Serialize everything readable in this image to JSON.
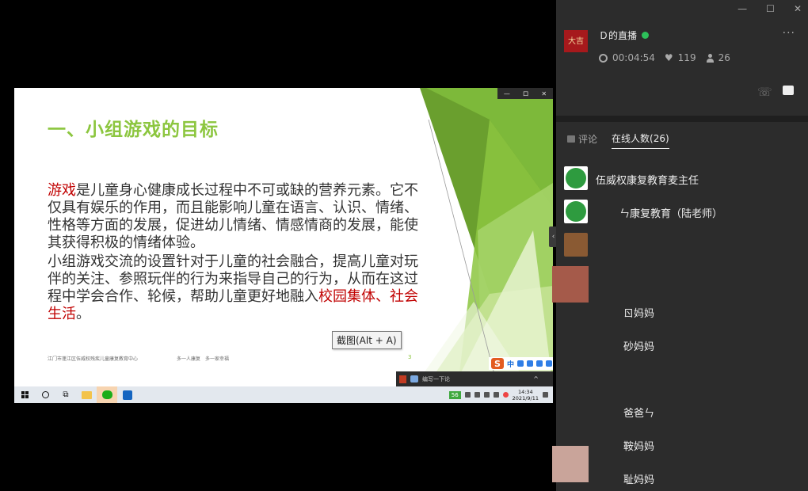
{
  "slide": {
    "title": "一、小组游戏的目标",
    "para1_highlight": "游戏",
    "para1_text": "是儿童身心健康成长过程中不可或缺的营养元素。它不仅具有娱乐的作用，而且能影响儿童在语言、认识、情绪、性格等方面的发展，促进幼儿情绪、情感情商的发展，能使其获得积极的情绪体验。",
    "para2_text": "小组游戏交流的设置针对于儿童的社会融合，提高儿童对玩伴的关注、参照玩伴的行为来指导自己的行为，从而在这过程中学会合作、轮候，帮助儿童更好地融入",
    "para2_highlight": "校园集体、社会生活",
    "para2_end": "。",
    "footer_org": "江门市蓬江区伍威权残疾儿童康复教育中心",
    "footer_slogan": "多一人康复　多一家幸福",
    "page_number": "3",
    "window_controls": [
      "—",
      "ロ",
      "✕"
    ]
  },
  "snip_tooltip": "截图(Alt + A)",
  "ime": {
    "text": "中"
  },
  "notification": {
    "text": "编写一下论"
  },
  "taskbar": {
    "battery": "56",
    "time": "14:34",
    "date": "2021/9/11"
  },
  "panel": {
    "window_controls": [
      "—",
      "☐",
      "✕"
    ],
    "host_avatar_text": "大吉",
    "live_title": "Ｄ的直播",
    "duration": "00:04:54",
    "likes": "119",
    "viewers": "26",
    "more": "···",
    "tabs": {
      "comment": "评论",
      "online": "在线人数(26)"
    },
    "members": [
      {
        "name": "伍威权康复教育麦主任"
      },
      {
        "name": "ㄣ康复教育（陆老师）"
      },
      {
        "name": ""
      },
      {
        "name": ""
      },
      {
        "name": "ㄖ妈妈"
      },
      {
        "name": "砂妈妈"
      },
      {
        "name": ""
      },
      {
        "name": "爸爸ㄣ"
      },
      {
        "name": "鞍妈妈"
      },
      {
        "name": "耻妈妈"
      }
    ]
  },
  "colors": {
    "slide_title": "#8cc63f",
    "highlight": "#c00000",
    "panel_bg": "#2c2c2c",
    "live_dot": "#2dc05a"
  }
}
